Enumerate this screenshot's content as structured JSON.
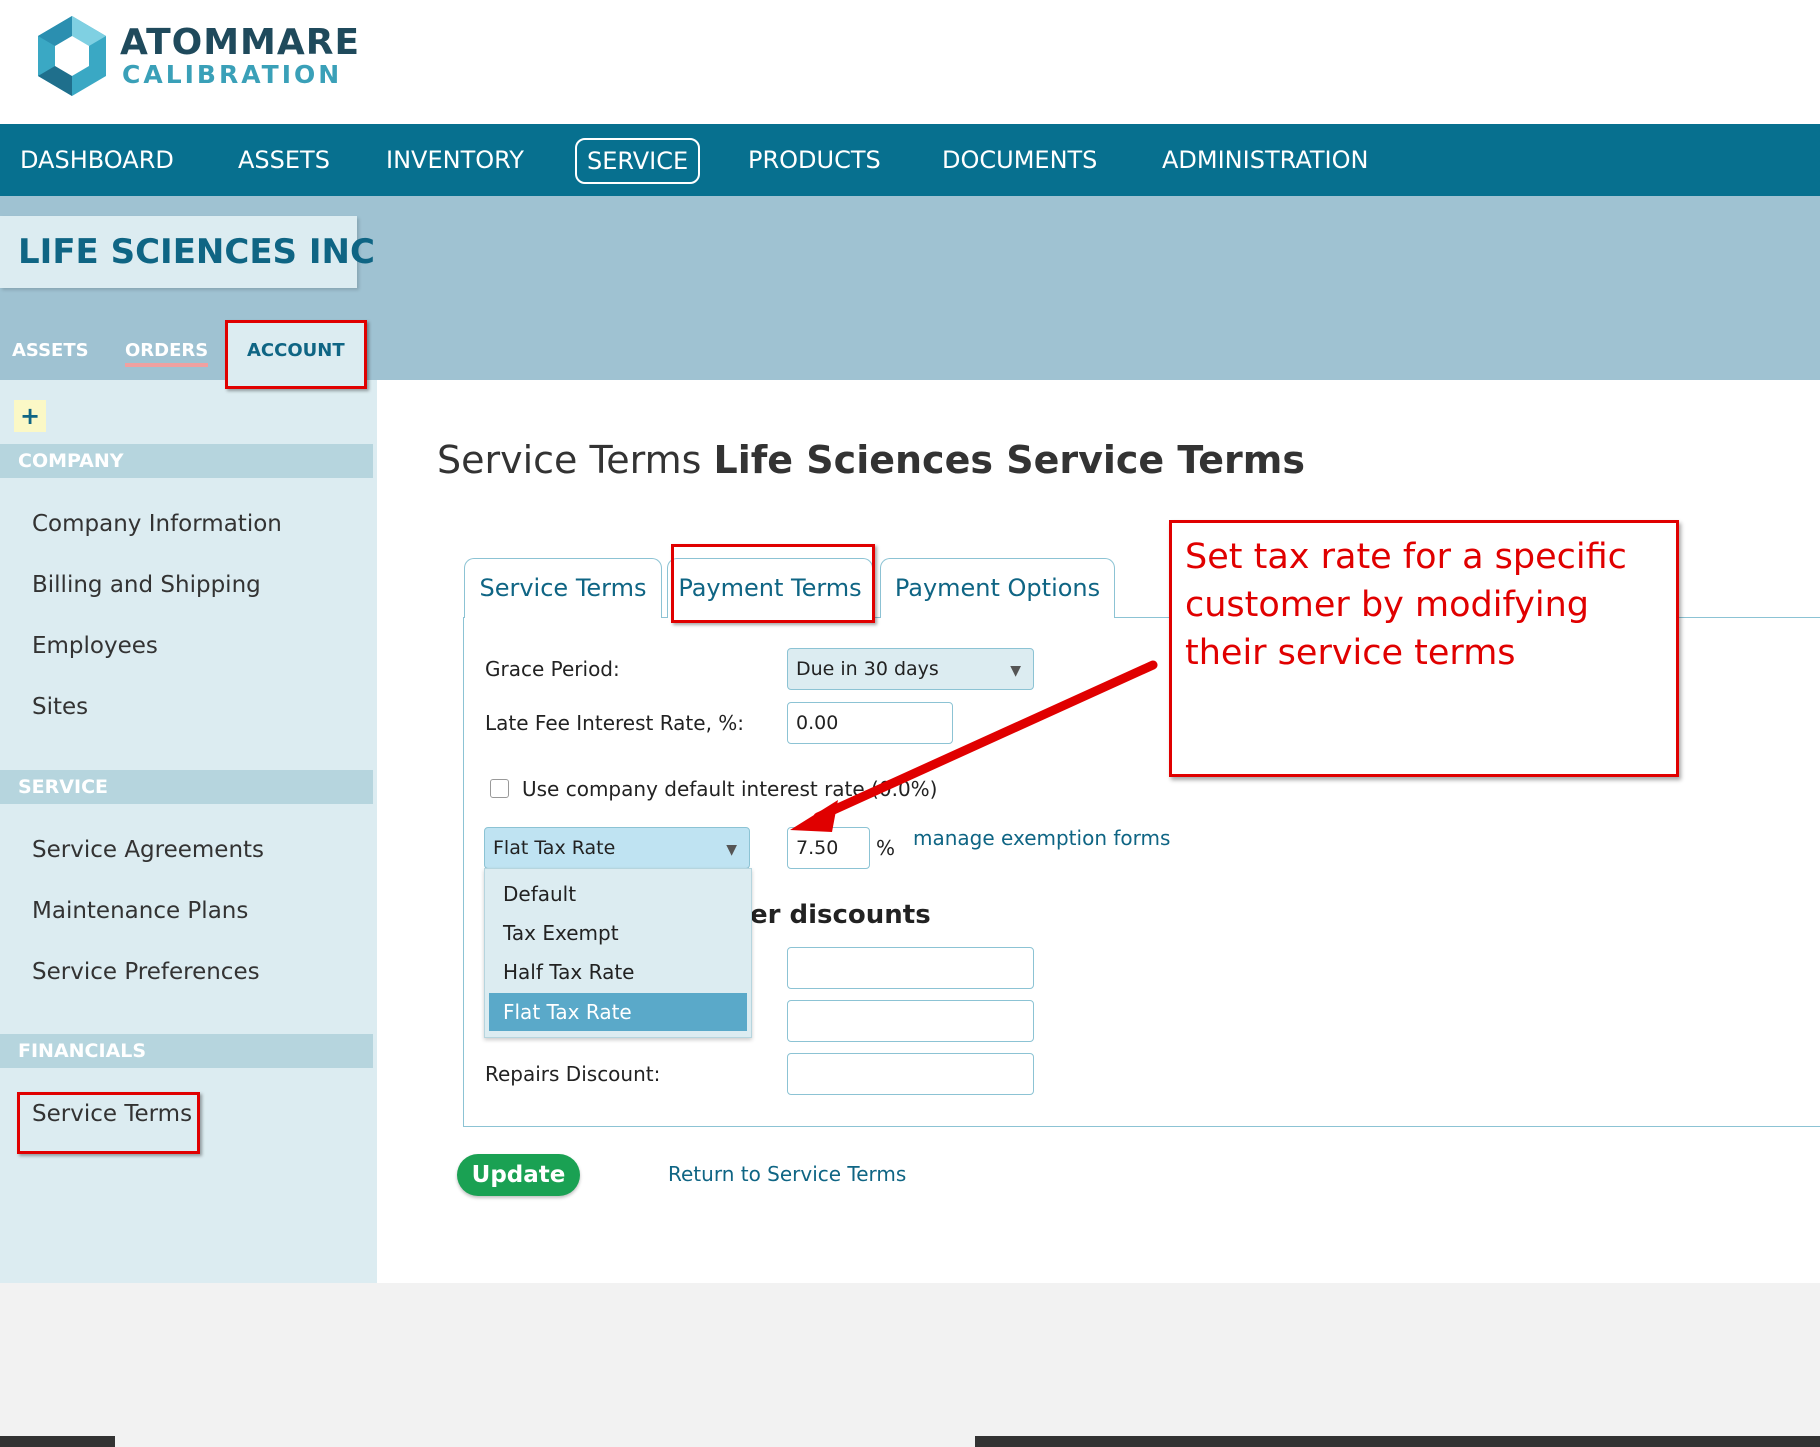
{
  "brand": {
    "name": "ATOMMARE",
    "tagline": "CALIBRATION"
  },
  "nav": {
    "items": [
      "DASHBOARD",
      "ASSETS",
      "INVENTORY",
      "SERVICE",
      "PRODUCTS",
      "DOCUMENTS",
      "ADMINISTRATION"
    ],
    "active": "SERVICE"
  },
  "company": {
    "title": "LIFE SCIENCES INC",
    "subtabs": [
      "ASSETS",
      "ORDERS",
      "ACCOUNT"
    ],
    "active_subtab": "ACCOUNT"
  },
  "sidebar": {
    "add_label": "+",
    "sections": [
      {
        "title": "COMPANY",
        "items": [
          "Company Information",
          "Billing and Shipping",
          "Employees",
          "Sites"
        ]
      },
      {
        "title": "SERVICE",
        "items": [
          "Service Agreements",
          "Maintenance Plans",
          "Service Preferences"
        ]
      },
      {
        "title": "FINANCIALS",
        "items": [
          "Service Terms"
        ]
      }
    ]
  },
  "page": {
    "title_prefix": "Service Terms",
    "title_name": "Life Sciences Service Terms"
  },
  "tabs": [
    "Service Terms",
    "Payment Terms",
    "Payment Options"
  ],
  "active_tab": "Payment Terms",
  "form": {
    "grace_period_label": "Grace Period:",
    "grace_period_value": "Due in 30 days",
    "late_fee_label": "Late Fee Interest Rate, %:",
    "late_fee_value": "0.00",
    "use_default_label": "Use company default interest rate (0.0%)",
    "use_default_checked": false,
    "tax_type_value": "Flat Tax Rate",
    "tax_rate_value": "7.50",
    "percent_sign": "%",
    "manage_link": "manage exemption forms",
    "discounts_heading": "er discounts",
    "repairs_discount_label": "Repairs Discount:",
    "discount_values": [
      "",
      "",
      ""
    ]
  },
  "dropdown": {
    "options": [
      "Default",
      "Tax Exempt",
      "Half Tax Rate",
      "Flat Tax Rate"
    ],
    "selected": "Flat Tax Rate"
  },
  "actions": {
    "update_label": "Update",
    "return_link": "Return to Service Terms"
  },
  "annotation": {
    "callout_text": "Set tax rate for a specific customer by modifying their service terms"
  },
  "colors": {
    "nav_bg": "#07708f",
    "banner_bg": "#9fc2d2",
    "sidebar_bg": "#dcecf1",
    "accent": "#0f6584",
    "update_green": "#1aa153",
    "annotation_red": "#e00000"
  }
}
